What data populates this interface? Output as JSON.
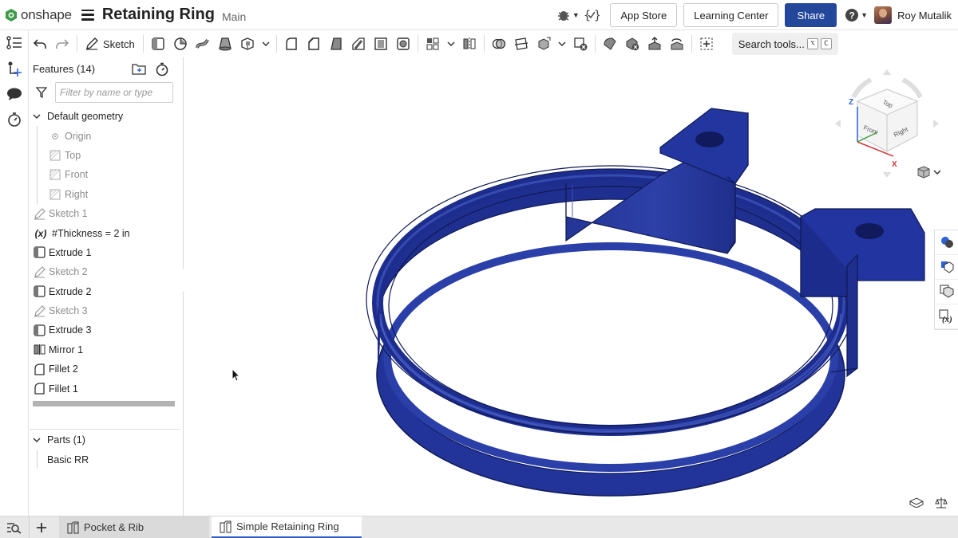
{
  "app": {
    "logo_text": "onshape"
  },
  "document": {
    "title": "Retaining Ring",
    "branch": "Main"
  },
  "header": {
    "app_store_label": "App Store",
    "learning_center_label": "Learning Center",
    "share_label": "Share",
    "user_name": "Roy Mutalik",
    "colors": {
      "share_bg": "#23489b",
      "text": "#222222"
    }
  },
  "toolbar": {
    "sketch_label": "Sketch",
    "search_label": "Search tools...",
    "search_shortcut": [
      "⌥",
      "C"
    ]
  },
  "features_panel": {
    "title": "Features (14)",
    "filter_placeholder": "Filter by name or type",
    "default_geometry_label": "Default geometry",
    "default_geometry": [
      "Origin",
      "Top",
      "Front",
      "Right"
    ],
    "items": [
      {
        "label": "Sketch 1",
        "icon": "sketch-icon",
        "suppressed_look": true
      },
      {
        "label": "#Thickness = 2 in",
        "icon": "variable-icon",
        "suppressed_look": false
      },
      {
        "label": "Extrude 1",
        "icon": "extrude-icon",
        "suppressed_look": false
      },
      {
        "label": "Sketch 2",
        "icon": "sketch-icon",
        "suppressed_look": true
      },
      {
        "label": "Extrude 2",
        "icon": "extrude-icon",
        "suppressed_look": false
      },
      {
        "label": "Sketch 3",
        "icon": "sketch-icon",
        "suppressed_look": true
      },
      {
        "label": "Extrude 3",
        "icon": "extrude-icon",
        "suppressed_look": false
      },
      {
        "label": "Mirror 1",
        "icon": "mirror-icon",
        "suppressed_look": false
      },
      {
        "label": "Fillet 2",
        "icon": "fillet-icon",
        "suppressed_look": false
      },
      {
        "label": "Fillet 1",
        "icon": "fillet-icon",
        "suppressed_look": false
      }
    ],
    "parts_title": "Parts (1)",
    "parts": [
      "Basic RR"
    ]
  },
  "view_cube": {
    "faces": [
      "Top",
      "Front",
      "Right"
    ],
    "axes": [
      "Z",
      "X"
    ]
  },
  "model": {
    "color": "#1f2f8f",
    "shade": "#2b3ea6",
    "highlight": "#5a6fd6"
  },
  "tabs": [
    {
      "label": "Pocket & Rib",
      "active": false
    },
    {
      "label": "Simple Retaining Ring",
      "active": true
    }
  ]
}
